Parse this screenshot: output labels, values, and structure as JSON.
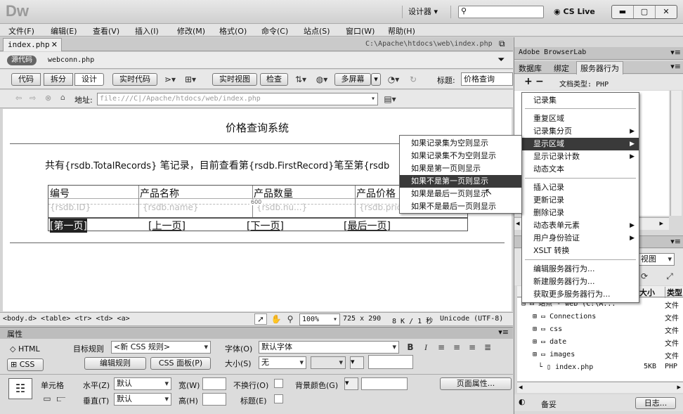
{
  "app": {
    "logo": "Dw",
    "workspace": "设计器",
    "cslive": "CS Live"
  },
  "menubar": [
    "文件(F)",
    "编辑(E)",
    "查看(V)",
    "插入(I)",
    "修改(M)",
    "格式(O)",
    "命令(C)",
    "站点(S)",
    "窗口(W)",
    "帮助(H)"
  ],
  "doc": {
    "tab": "index.php",
    "path": "C:\\Apache\\htdocs\\web\\index.php",
    "source_badge": "源代码",
    "related_file": "webconn.php"
  },
  "toolbar": {
    "code": "代码",
    "split": "拆分",
    "design": "设计",
    "live_code": "实时代码",
    "live_view": "实时视图",
    "inspect": "检查",
    "multiscreen": "多屏幕",
    "title_label": "标题:",
    "title_value": "价格查询"
  },
  "address": {
    "label": "地址:",
    "value": "file:///C|/Apache/htdocs/web/index.php"
  },
  "design": {
    "heading": "价格查询系统",
    "record_line": {
      "a": "共有",
      "b": "{rsdb.TotalRecords}",
      "c": " 笔记录，目前查看第",
      "d": "{rsdb.FirstRecord}",
      "e": "笔至第",
      "f": "{rsdb"
    },
    "headers": [
      "编号",
      "产品名称",
      "产品数量",
      "产品价格"
    ],
    "cells": [
      "{rsdb.ID}",
      "{rsdb.name}",
      "{rsdb.nu...}",
      "{rsdb.pric..."
    ],
    "width_marker": "600",
    "nav": [
      "[第一页]",
      "[上一页]",
      "[下一页]",
      "[最后一页]"
    ]
  },
  "status": {
    "tags": "<body.d> <table> <tr> <td> <a>",
    "zoom": "100%",
    "size": "725 x 290",
    "kb": "8 K / 1 秒",
    "encoding": "Unicode (UTF-8)"
  },
  "props": {
    "title": "属性",
    "html": "HTML",
    "css": "CSS",
    "target_rule_label": "目标规则",
    "target_rule": "<新 CSS 规则>",
    "edit_rule": "编辑规则",
    "css_panel": "CSS 面板(P)",
    "font_label": "字体(O)",
    "font_value": "默认字体",
    "size_label": "大小(S)",
    "size_value": "无",
    "cell_label": "单元格",
    "h_label": "水平(Z)",
    "h_value": "默认",
    "w_label": "宽(W)",
    "nowrap_label": "不换行(O)",
    "bg_label": "背景颜色(G)",
    "page_props": "页面属性...",
    "v_label": "垂直(T)",
    "v_value": "默认",
    "ht_label": "高(H)",
    "header_label": "标题(E)"
  },
  "right": {
    "browserlab": "Adobe BrowserLab",
    "tabs": [
      "数据库",
      "绑定",
      "服务器行为"
    ],
    "doc_type": "文档类型: PHP",
    "view_label": "视图",
    "col_size": "大小",
    "col_type": "类型",
    "site": "站点 - web (C:\\A...",
    "files": [
      {
        "name": "Connections",
        "type": "文件"
      },
      {
        "name": "css",
        "type": "文件"
      },
      {
        "name": "date",
        "type": "文件"
      },
      {
        "name": "images",
        "type": "文件"
      },
      {
        "name": "index.php",
        "size": "5KB",
        "type": "PHP"
      }
    ],
    "ready": "备妥",
    "log": "日志..."
  },
  "context_menu": [
    "记录集",
    "重复区域",
    "记录集分页",
    "显示区域",
    "显示记录计数",
    "动态文本",
    "插入记录",
    "更新记录",
    "删除记录",
    "动态表单元素",
    "用户身份验证",
    "XSLT 转换",
    "编辑服务器行为...",
    "新建服务器行为...",
    "获取更多服务器行为..."
  ],
  "submenu": [
    "如果记录集为空则显示",
    "如果记录集不为空则显示",
    "如果是第一页则显示",
    "如果不是第一页则显示",
    "如果是最后一页则显示",
    "如果不是最后一页则显示"
  ]
}
